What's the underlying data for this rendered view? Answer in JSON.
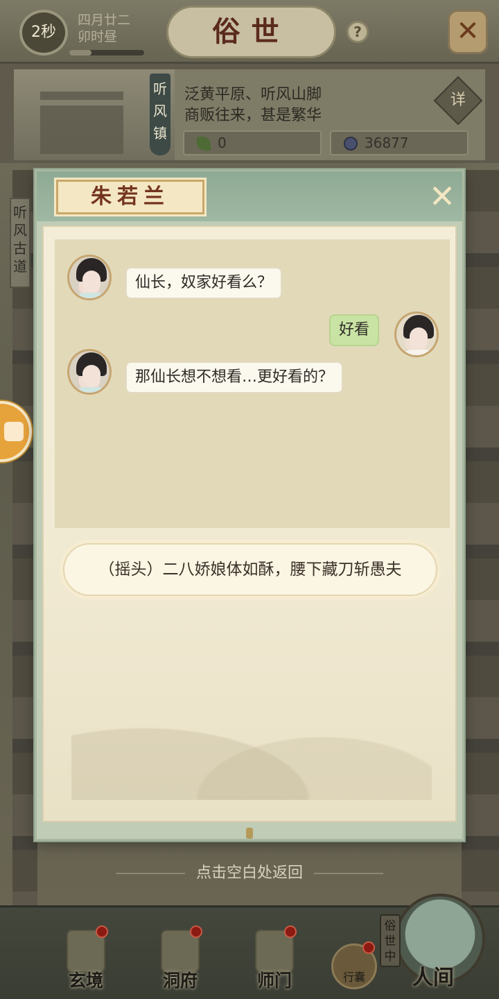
{
  "topbar": {
    "timer": "2秒",
    "date": "四月廿二",
    "time_of_day": "卯时昼",
    "title": "俗世",
    "help": "?",
    "close": "✕"
  },
  "location": {
    "name": "听风镇",
    "desc_line1": "泛黄平原、听风山脚",
    "desc_line2": "商贩往来，甚是繁华",
    "detail_label": "详",
    "resource_leaf": "0",
    "resource_coin": "36877"
  },
  "background": {
    "left_sign": "听风古道"
  },
  "dialog": {
    "npc_name": "朱若兰",
    "close": "✕",
    "messages": [
      {
        "speaker": "npc",
        "text": "仙长，奴家好看么？"
      },
      {
        "speaker": "player",
        "text": "好看"
      },
      {
        "speaker": "npc",
        "text": "那仙长想不想看…更好看的？"
      }
    ],
    "option": "（摇头）二八娇娘体如酥，腰下藏刀斩愚夫"
  },
  "return_hint": "点击空白处返回",
  "bottom_nav": {
    "items": [
      {
        "label": "玄境"
      },
      {
        "label": "洞府"
      },
      {
        "label": "师门"
      }
    ],
    "bag_label": "行囊",
    "world_tag": "俗世中",
    "world_label": "人间"
  },
  "colors": {
    "dialog_frame": "#c1ccb7",
    "paper": "#f1ead3",
    "player_bubble": "#c9e3a4",
    "name_text": "#74341f"
  }
}
